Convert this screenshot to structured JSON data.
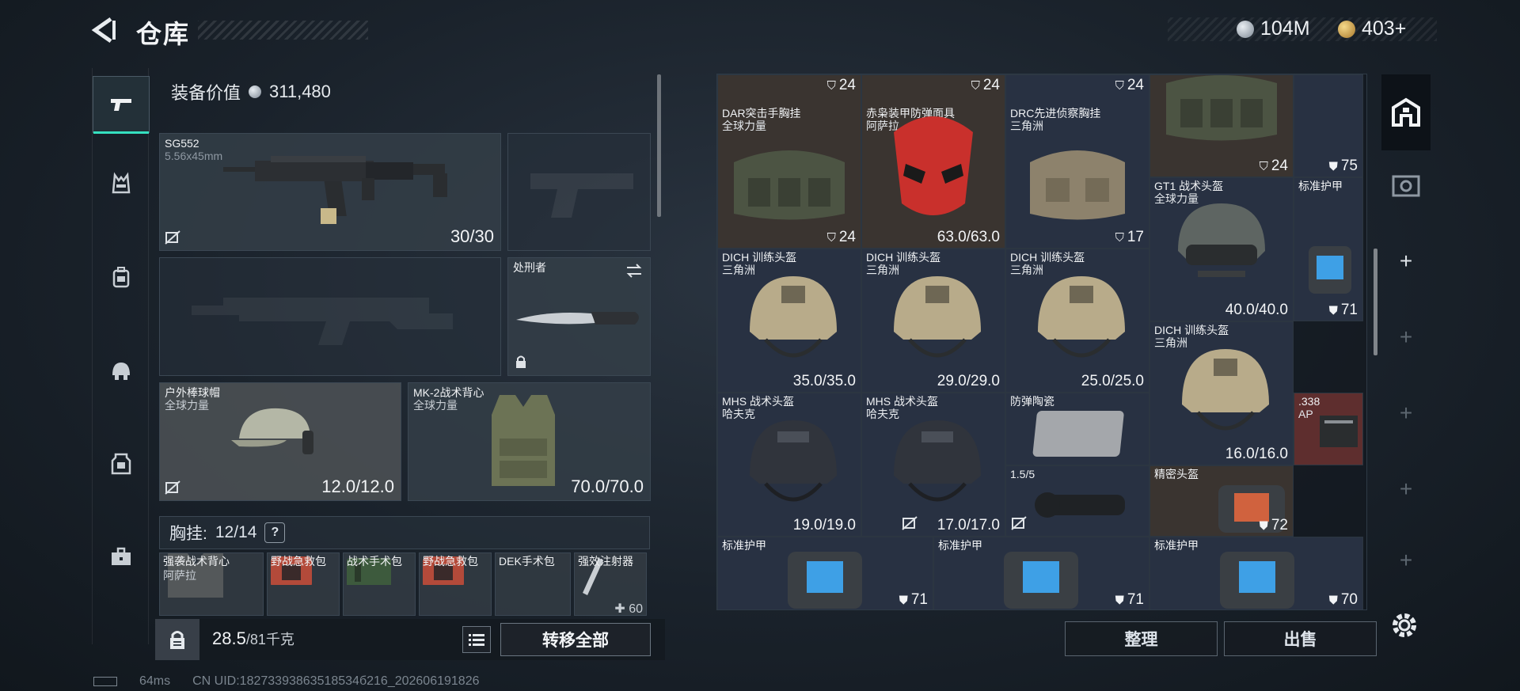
{
  "header": {
    "title": "仓库",
    "currency_silver": "104M",
    "currency_gold": "403+"
  },
  "left_rail": {
    "items": [
      {
        "icon": "pistol-icon",
        "active": true
      },
      {
        "icon": "chest-rig-icon"
      },
      {
        "icon": "backpack-icon"
      },
      {
        "icon": "helmet-icon"
      },
      {
        "icon": "armor-vest-icon"
      },
      {
        "icon": "toolbox-icon"
      }
    ]
  },
  "equipment": {
    "value_label": "装备价值",
    "value": "311,480",
    "primary_weapon": {
      "name": "SG552",
      "caliber": "5.56x45mm",
      "ammo": "30/30"
    },
    "melee": {
      "name": "处刑者"
    },
    "helmet": {
      "name": "户外棒球帽",
      "faction": "全球力量",
      "durability": "12.0/12.0"
    },
    "armor": {
      "name": "MK-2战术背心",
      "faction": "全球力量",
      "durability": "70.0/70.0"
    },
    "chest_rig": {
      "label": "胸挂:",
      "capacity": "12/14",
      "help": "?",
      "items": [
        {
          "name": "强袭战术背心",
          "sub": "阿萨拉",
          "val": ""
        },
        {
          "name": "野战急救包",
          "sub": "",
          "val": ""
        },
        {
          "name": "战术手术包",
          "sub": "",
          "val": ""
        },
        {
          "name": "野战急救包",
          "sub": "",
          "val": ""
        },
        {
          "name": "DEK手术包",
          "sub": "",
          "val": ""
        },
        {
          "name": "强效注射器",
          "sub": "",
          "val": "60"
        }
      ]
    }
  },
  "footer_left": {
    "weight": "28.5",
    "weight_max": "/81千克",
    "transfer_all": "转移全部"
  },
  "status": {
    "ping": "64ms",
    "uid": "CN UID:18273393863518534б216_202606191826"
  },
  "storage": {
    "cells": [
      {
        "id": "c1",
        "name": "DAR突击手胸挂",
        "sub": "全球力量",
        "val": "24",
        "topval": "24"
      },
      {
        "id": "c2",
        "name": "赤枭装甲防弹面具",
        "sub": "阿萨拉",
        "val": "63.0/63.0",
        "topval": "24"
      },
      {
        "id": "c3",
        "name": "DRC先进侦察胸挂",
        "sub": "三角洲",
        "val": "17",
        "topval": "24"
      },
      {
        "id": "c4",
        "name": "",
        "sub": "",
        "val": "24",
        "topval": ""
      },
      {
        "id": "c5",
        "name": "",
        "sub": "",
        "val": "75",
        "topval": ""
      },
      {
        "id": "c6",
        "name": "GT1 战术头盔",
        "sub": "全球力量",
        "val": "40.0/40.0",
        "topval": ""
      },
      {
        "id": "c7",
        "name": "标准护甲",
        "sub": "",
        "val": "71",
        "topval": ""
      },
      {
        "id": "c8",
        "name": "DICH 训练头盔",
        "sub": "三角洲",
        "val": "35.0/35.0",
        "topval": ""
      },
      {
        "id": "c9",
        "name": "DICH 训练头盔",
        "sub": "三角洲",
        "val": "29.0/29.0",
        "topval": ""
      },
      {
        "id": "c10",
        "name": "DICH 训练头盔",
        "sub": "三角洲",
        "val": "25.0/25.0",
        "topval": ""
      },
      {
        "id": "c11",
        "name": "DICH 训练头盔",
        "sub": "三角洲",
        "val": "16.0/16.0",
        "topval": ""
      },
      {
        "id": "c12",
        "name": ".338",
        "sub": "AP",
        "val": "",
        "topval": ""
      },
      {
        "id": "c13",
        "name": "MHS 战术头盔",
        "sub": "哈夫克",
        "val": "19.0/19.0",
        "topval": ""
      },
      {
        "id": "c14",
        "name": "MHS 战术头盔",
        "sub": "哈夫克",
        "val": "17.0/17.0",
        "topval": ""
      },
      {
        "id": "c15",
        "name": "防弹陶瓷",
        "sub": "",
        "val": "",
        "topval": ""
      },
      {
        "id": "c16",
        "name": "1.5/5",
        "sub": "",
        "val": "",
        "topval": ""
      },
      {
        "id": "c17",
        "name": "精密头盔",
        "sub": "",
        "val": "72",
        "topval": ""
      },
      {
        "id": "c18",
        "name": "标准护甲",
        "sub": "",
        "val": "71",
        "topval": ""
      },
      {
        "id": "c19",
        "name": "标准护甲",
        "sub": "",
        "val": "71",
        "topval": ""
      },
      {
        "id": "c20",
        "name": "标准护甲",
        "sub": "",
        "val": "70",
        "topval": ""
      }
    ],
    "sort_button": "整理",
    "sell_button": "出售"
  },
  "right_rail": {
    "items": [
      "warehouse-icon",
      "showcase-icon",
      "+",
      "+",
      "+",
      "+",
      "+"
    ]
  },
  "colors": {
    "accent": "#35e0c0",
    "cell_blue": "#283142",
    "cell_brown": "#3a3430",
    "cell_red": "#5e2e2e"
  }
}
